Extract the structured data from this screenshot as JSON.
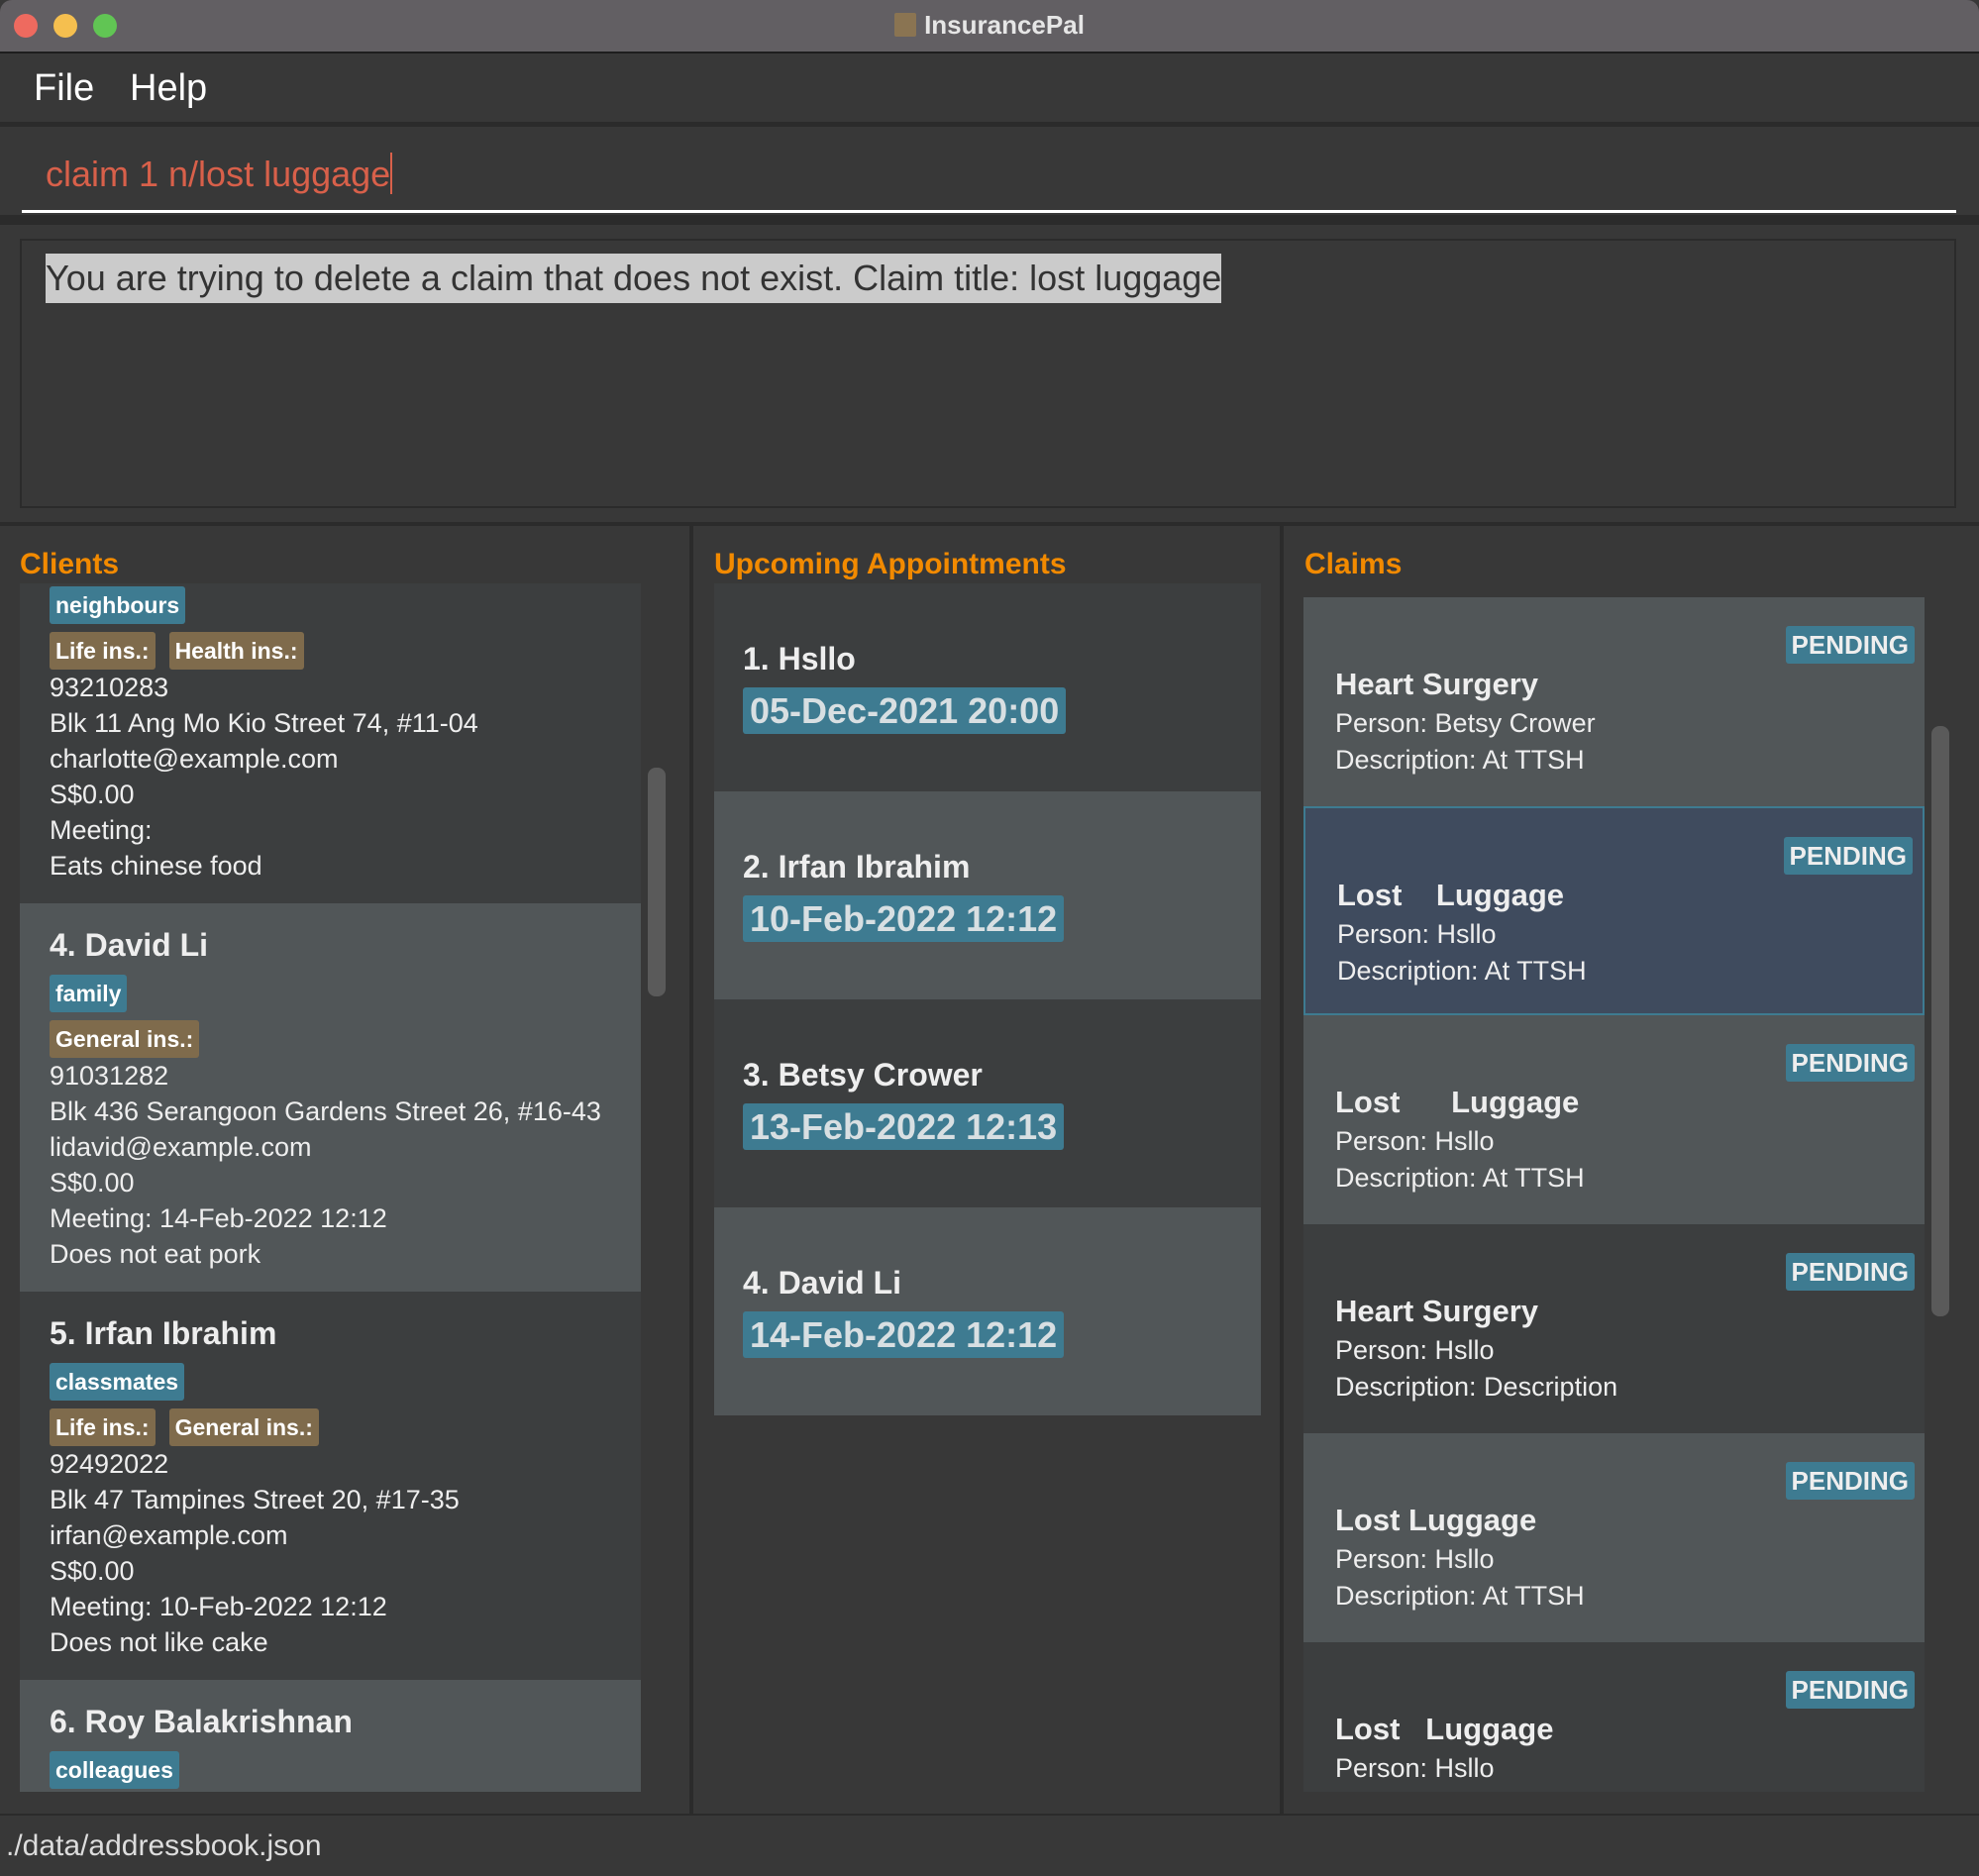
{
  "window": {
    "title": "InsurancePal"
  },
  "menu": {
    "file": "File",
    "help": "Help"
  },
  "command": {
    "value": "claim 1 n/lost luggage"
  },
  "result": {
    "text": "You are trying to delete a claim that does not exist. Claim title: lost luggage"
  },
  "clients": {
    "heading": "Clients",
    "items": [
      {
        "name": "",
        "tags": [
          "neighbours"
        ],
        "insurance": [
          "Life ins.:",
          "Health ins.:"
        ],
        "phone": "93210283",
        "address": "Blk 11 Ang Mo Kio Street 74, #11-04",
        "email": "charlotte@example.com",
        "revenue": "S$0.00",
        "meeting": "Meeting:",
        "remark": "Eats chinese food"
      },
      {
        "name": "4.  David Li",
        "tags": [
          "family"
        ],
        "insurance": [
          "General ins.:"
        ],
        "phone": "91031282",
        "address": "Blk 436 Serangoon Gardens Street 26, #16-43",
        "email": "lidavid@example.com",
        "revenue": "S$0.00",
        "meeting": "Meeting: 14-Feb-2022 12:12",
        "remark": "Does not eat pork"
      },
      {
        "name": "5.  Irfan Ibrahim",
        "tags": [
          "classmates"
        ],
        "insurance": [
          "Life ins.:",
          "General ins.:"
        ],
        "phone": "92492022",
        "address": "Blk 47 Tampines Street 20, #17-35",
        "email": "irfan@example.com",
        "revenue": "S$0.00",
        "meeting": "Meeting: 10-Feb-2022 12:12",
        "remark": "Does not like cake"
      },
      {
        "name": "6.  Roy Balakrishnan",
        "tags": [
          "colleagues"
        ],
        "insurance": [],
        "phone": "",
        "address": "",
        "email": "",
        "revenue": "",
        "meeting": "",
        "remark": ""
      }
    ]
  },
  "appointments": {
    "heading": "Upcoming Appointments",
    "items": [
      {
        "name": "1.  Hsllo",
        "date": "05-Dec-2021 20:00"
      },
      {
        "name": "2.  Irfan Ibrahim",
        "date": "10-Feb-2022 12:12"
      },
      {
        "name": "3.  Betsy Crower",
        "date": "13-Feb-2022 12:13"
      },
      {
        "name": "4.  David Li",
        "date": "14-Feb-2022 12:12"
      }
    ]
  },
  "claims": {
    "heading": "Claims",
    "items": [
      {
        "title": "Heart Surgery",
        "person": "Person: Betsy Crower",
        "description": "Description: At TTSH",
        "status": "PENDING"
      },
      {
        "title": "Lost    Luggage",
        "person": "Person: Hsllo",
        "description": "Description: At TTSH",
        "status": "PENDING",
        "selected": true
      },
      {
        "title": "Lost      Luggage",
        "person": "Person: Hsllo",
        "description": "Description: At TTSH",
        "status": "PENDING"
      },
      {
        "title": "Heart Surgery",
        "person": "Person: Hsllo",
        "description": "Description: Description",
        "status": "PENDING"
      },
      {
        "title": "Lost Luggage",
        "person": "Person: Hsllo",
        "description": "Description: At TTSH",
        "status": "PENDING"
      },
      {
        "title": "Lost   Luggage",
        "person": "Person: Hsllo",
        "description": "",
        "status": "PENDING"
      }
    ]
  },
  "status": {
    "path": "./data/addressbook.json"
  },
  "colors": {
    "accent": "#f28a00",
    "tag": "#3e7b91",
    "insurance_tag": "#7f6b4c",
    "command_text": "#d8604a"
  }
}
